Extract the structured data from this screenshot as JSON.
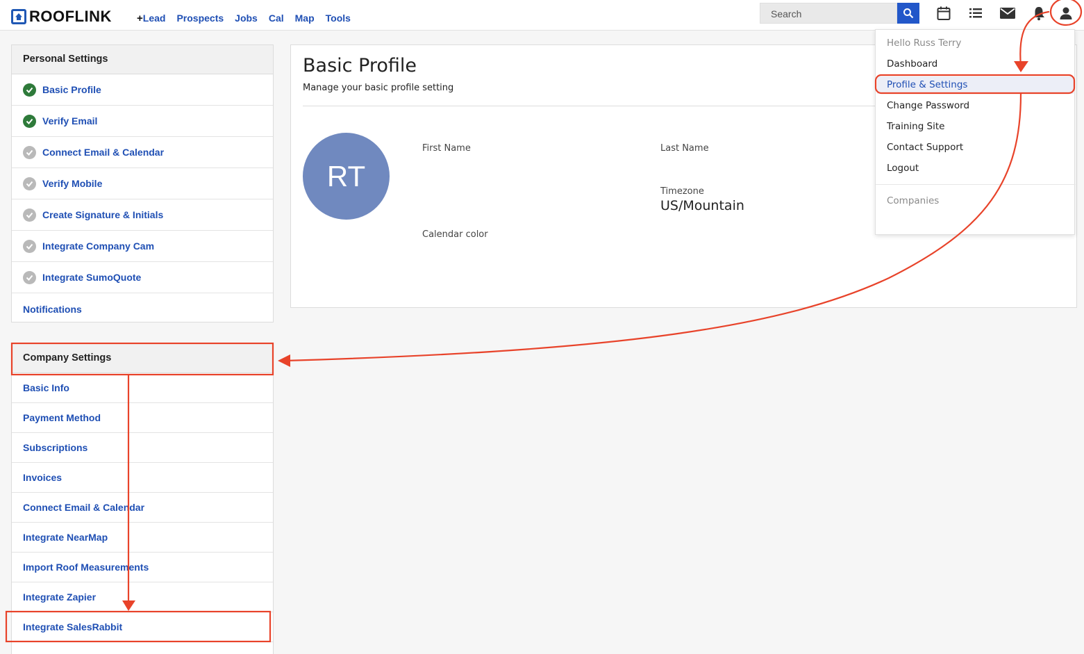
{
  "brand": {
    "name": "ROOFLINK",
    "accent": "#1f57b4"
  },
  "nav": {
    "plus": "+",
    "lead": "Lead",
    "prospects": "Prospects",
    "jobs": "Jobs",
    "cal": "Cal",
    "map": "Map",
    "tools": "Tools"
  },
  "search": {
    "placeholder": "Search"
  },
  "topbar_icons": [
    "calendar-icon",
    "list-icon",
    "mail-icon",
    "bell-icon",
    "user-icon"
  ],
  "personal_settings": {
    "title": "Personal Settings",
    "items": [
      {
        "label": "Basic Profile",
        "status": "done"
      },
      {
        "label": "Verify Email",
        "status": "done"
      },
      {
        "label": "Connect Email & Calendar",
        "status": "todo"
      },
      {
        "label": "Verify Mobile",
        "status": "todo"
      },
      {
        "label": "Create Signature & Initials",
        "status": "todo"
      },
      {
        "label": "Integrate Company Cam",
        "status": "todo"
      },
      {
        "label": "Integrate SumoQuote",
        "status": "todo"
      },
      {
        "label": "Notifications",
        "status": "none"
      }
    ]
  },
  "company_settings": {
    "title": "Company Settings",
    "items": [
      "Basic Info",
      "Payment Method",
      "Subscriptions",
      "Invoices",
      "Connect Email & Calendar",
      "Integrate NearMap",
      "Import Roof Measurements",
      "Integrate Zapier",
      "Integrate SalesRabbit"
    ]
  },
  "profile": {
    "title": "Basic Profile",
    "subtitle": "Manage your basic profile setting",
    "initials": "RT",
    "first_name_label": "First Name",
    "last_name_label": "Last Name",
    "timezone_label": "Timezone",
    "timezone_value": "US/Mountain",
    "calendar_color_label": "Calendar color"
  },
  "user_menu": {
    "greeting": "Hello Russ Terry",
    "items": [
      "Dashboard",
      "Profile & Settings",
      "Change Password",
      "Training Site",
      "Contact Support",
      "Logout"
    ],
    "selected": "Profile & Settings",
    "companies_label": "Companies"
  },
  "colors": {
    "link": "#1f4fb4",
    "done": "#2e7a3a",
    "todo": "#b9b9b9",
    "annotation": "#e8432a",
    "avatar": "#7089bf"
  }
}
